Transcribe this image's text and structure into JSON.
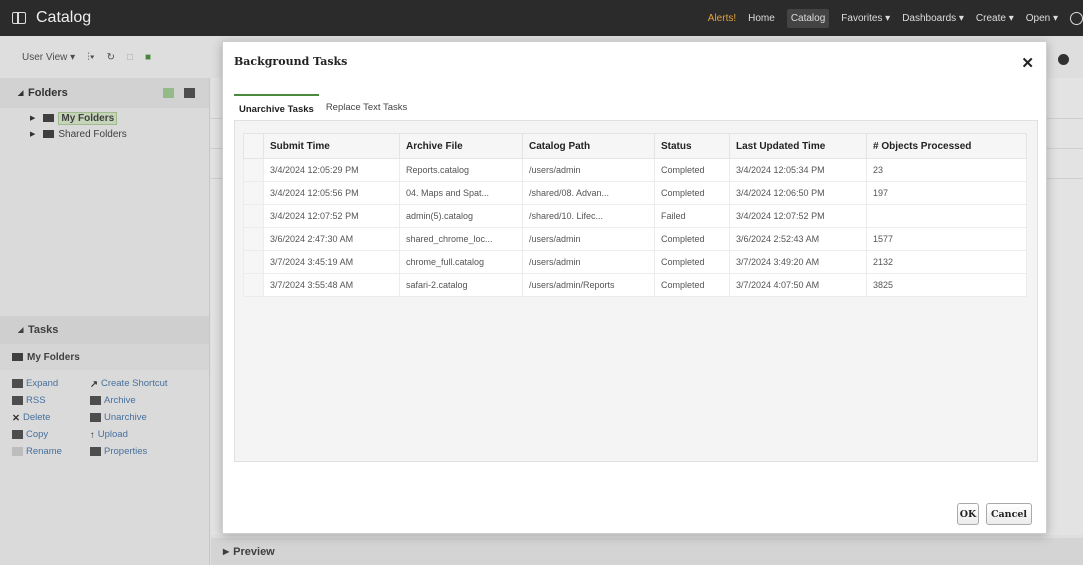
{
  "app": {
    "title": "Catalog"
  },
  "topnav": {
    "alerts": "Alerts!",
    "home": "Home",
    "catalog": "Catalog",
    "favorites": "Favorites ▾",
    "dashboards": "Dashboards ▾",
    "create": "Create ▾",
    "open": "Open ▾"
  },
  "toolbar": {
    "user_view": "User View ▾"
  },
  "folders": {
    "header": "Folders",
    "items": [
      {
        "label": "My Folders"
      },
      {
        "label": "Shared Folders"
      }
    ]
  },
  "tasks": {
    "header": "Tasks",
    "context": "My Folders",
    "items": [
      {
        "label": "Expand",
        "icon": "expand-icon"
      },
      {
        "label": "Create Shortcut",
        "icon": "shortcut-icon"
      },
      {
        "label": "RSS",
        "icon": "rss-icon"
      },
      {
        "label": "Archive",
        "icon": "archive-icon"
      },
      {
        "label": "Delete",
        "icon": "delete-icon"
      },
      {
        "label": "Unarchive",
        "icon": "unarchive-icon"
      },
      {
        "label": "Copy",
        "icon": "copy-icon"
      },
      {
        "label": "Upload",
        "icon": "upload-icon"
      },
      {
        "label": "Rename",
        "icon": "rename-icon"
      },
      {
        "label": "Properties",
        "icon": "properties-icon"
      }
    ]
  },
  "preview": {
    "label": "Preview"
  },
  "dialog": {
    "title": "Background Tasks",
    "tabs": [
      {
        "label": "Unarchive Tasks"
      },
      {
        "label": "Replace Text Tasks"
      }
    ],
    "columns": [
      "Submit Time",
      "Archive File",
      "Catalog Path",
      "Status",
      "Last Updated Time",
      "# Objects Processed"
    ],
    "rows": [
      [
        "3/4/2024 12:05:29 PM",
        "Reports.catalog",
        "/users/admin",
        "Completed",
        "3/4/2024 12:05:34 PM",
        "23"
      ],
      [
        "3/4/2024 12:05:56 PM",
        "04. Maps and Spat...",
        "/shared/08. Advan...",
        "Completed",
        "3/4/2024 12:06:50 PM",
        "197"
      ],
      [
        "3/4/2024 12:07:52 PM",
        "admin(5).catalog",
        "/shared/10. Lifec...",
        "Failed",
        "3/4/2024 12:07:52 PM",
        ""
      ],
      [
        "3/6/2024 2:47:30 AM",
        "shared_chrome_loc...",
        "/users/admin",
        "Completed",
        "3/6/2024 2:52:43 AM",
        "1577"
      ],
      [
        "3/7/2024 3:45:19 AM",
        "chrome_full.catalog",
        "/users/admin",
        "Completed",
        "3/7/2024 3:49:20 AM",
        "2132"
      ],
      [
        "3/7/2024 3:55:48 AM",
        "safari-2.catalog",
        "/users/admin/Reports",
        "Completed",
        "3/7/2024 4:07:50 AM",
        "3825"
      ]
    ],
    "ok_label": "OK",
    "cancel_label": "Cancel"
  },
  "colors": {
    "topbar": "#2b2b2b",
    "alerts": "#e5a23b",
    "accent_green": "#4a8a3f",
    "link_blue": "#3b6ea5"
  }
}
